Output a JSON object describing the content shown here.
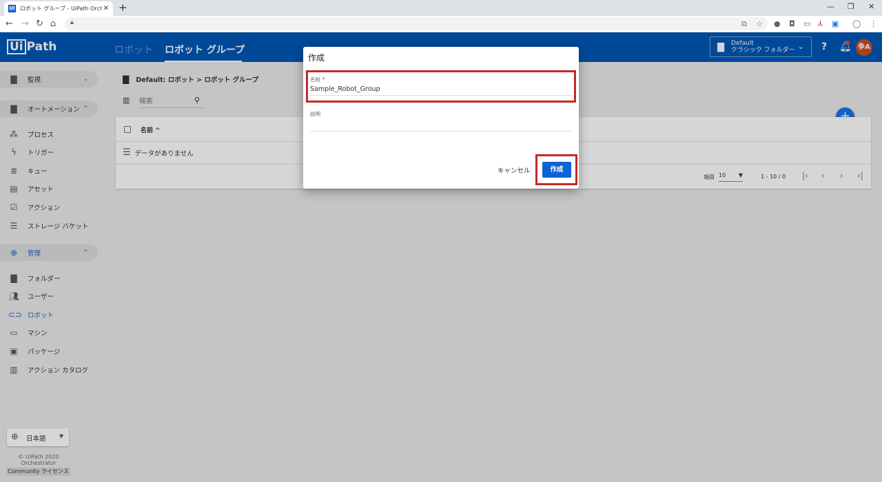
{
  "browser": {
    "tab_title": "ロボット グループ - UiPath Orchestrator",
    "tab_favicon": "Ui",
    "tab_close": "✕",
    "new_tab": "+",
    "minimize": "—",
    "restore": "❐",
    "close": "✕",
    "icons": [
      "back-icon",
      "forward-icon",
      "reload-icon",
      "home-icon",
      "lock-icon",
      "translate-icon",
      "star-icon",
      "extension-icon",
      "camera-icon",
      "chat-icon",
      "pdf-icon",
      "uipath-icon",
      "profile-icon",
      "menu-icon"
    ]
  },
  "header": {
    "logo_box": "Ui",
    "logo_text": "Path",
    "tabs": [
      {
        "label": "ロボット",
        "active": false
      },
      {
        "label": "ロボット グループ",
        "active": true
      }
    ],
    "folder": {
      "line1": "Default",
      "line2": "クラシック フォルダー"
    },
    "help_icon": "?",
    "bell_icon": "bell-icon",
    "avatar": "争A",
    "accent_color": "#0057b7"
  },
  "sidebar": {
    "groups": [
      {
        "label": "監視",
        "chevron": "⌄",
        "icon": "folder-icon"
      },
      {
        "label": "オートメーション",
        "chevron": "^",
        "icon": "folder-icon"
      },
      {
        "label": "管理",
        "chevron": "^",
        "icon": "globe-icon"
      }
    ],
    "automation_items": [
      {
        "label": "プロセス",
        "icon": "process-icon"
      },
      {
        "label": "トリガー",
        "icon": "trigger-icon"
      },
      {
        "label": "キュー",
        "icon": "queue-icon"
      },
      {
        "label": "アセット",
        "icon": "asset-icon"
      },
      {
        "label": "アクション",
        "icon": "action-icon"
      },
      {
        "label": "ストレージ バケット",
        "icon": "storage-icon"
      }
    ],
    "admin_items": [
      {
        "label": "フォルダー",
        "icon": "folder-icon"
      },
      {
        "label": "ユーザー",
        "icon": "users-icon"
      },
      {
        "label": "ロボット",
        "icon": "robot-icon",
        "active": true
      },
      {
        "label": "マシン",
        "icon": "machine-icon"
      },
      {
        "label": "パッケージ",
        "icon": "package-icon"
      },
      {
        "label": "アクション カタログ",
        "icon": "catalog-icon"
      }
    ],
    "language": "日本語",
    "footer_line1": "© UiPath 2020",
    "footer_line2": "Orchestrator",
    "license": "Community ライセンス"
  },
  "main": {
    "breadcrumb": "Default: ロボット > ロボット グループ",
    "search_placeholder": "検索",
    "table": {
      "column_name": "名前 ^",
      "empty_text": "データがありません",
      "items_label": "項目",
      "page_size": "10",
      "range": "1 - 10 / 0"
    }
  },
  "dialog": {
    "title": "作成",
    "name_label": "名前 *",
    "name_value": "Sample_Robot_Group",
    "description_label": "説明",
    "description_value": "",
    "cancel_label": "キャンセル",
    "create_label": "作成",
    "highlight_color": "#c62828",
    "primary_color": "#0d62d6"
  }
}
